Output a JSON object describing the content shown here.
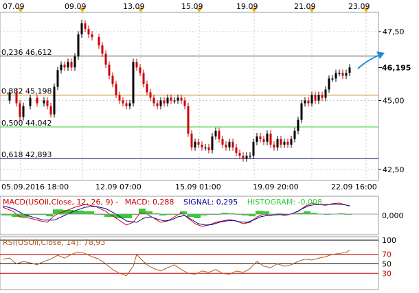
{
  "top_dates": [
    "07.09",
    "09.09",
    "13.09",
    "15.09",
    "19.09",
    "21.09",
    "23.09"
  ],
  "bottom_dates": [
    "05.09.2016 18:00",
    "12.09 07:00",
    "15.09 01:00",
    "19.09 20:00",
    "22.09 16:00"
  ],
  "price_axis": {
    "labels": [
      "47,50",
      "45,00",
      "42,50"
    ],
    "values": [
      47.5,
      45.0,
      42.5
    ]
  },
  "current_price": {
    "label": "46,195",
    "value": 46.195
  },
  "fib_levels": [
    {
      "label": "0,236 46,612",
      "value": 46.612,
      "color": "#555555"
    },
    {
      "label": "0,382 45,198",
      "value": 45.198,
      "color": "#cc7a00"
    },
    {
      "label": "0,500 44,042",
      "value": 44.042,
      "color": "#33cc33"
    },
    {
      "label": "0,618 42,893",
      "value": 42.893,
      "color": "#000066"
    }
  ],
  "macd": {
    "label_prefix": "MACD(USOil,Close, 12, 26, 9) -",
    "macd_label": "MACD: 0,288",
    "signal_label": "SIGNAL: 0,295",
    "histogram_label": "HISTOGRAM: -0,008",
    "zero_label": "0,000",
    "colors": {
      "macd": "#cc0000",
      "signal": "#000099",
      "histogram": "#33cc33"
    }
  },
  "rsi": {
    "label": "RSI(USOil,Close, 14): 78,93",
    "levels": [
      "100",
      "70",
      "50",
      "30"
    ],
    "level_values": [
      100,
      70,
      50,
      30
    ],
    "color": "#b05a1a"
  },
  "colors": {
    "bull": "#000000",
    "bear": "#cc0000",
    "arrow": "#1a8fd6",
    "marker": "#f5a623",
    "grid": "#c8c8c8"
  },
  "chart_data": {
    "type": "line",
    "title": "",
    "price_range": [
      42.1,
      48.2
    ],
    "x_range": [
      0,
      108
    ],
    "price": [
      [
        0,
        45.0
      ],
      [
        2,
        45.3
      ],
      [
        4,
        44.9
      ],
      [
        5,
        44.4
      ],
      [
        6,
        44.8
      ],
      [
        8,
        45.1
      ],
      [
        10,
        44.9
      ],
      [
        12,
        45.0
      ],
      [
        13,
        44.8
      ],
      [
        14,
        44.5
      ],
      [
        15,
        45.5
      ],
      [
        16,
        46.1
      ],
      [
        17,
        46.3
      ],
      [
        18,
        46.2
      ],
      [
        19,
        46.4
      ],
      [
        20,
        46.2
      ],
      [
        21,
        46.6
      ],
      [
        22,
        47.4
      ],
      [
        23,
        47.8
      ],
      [
        24,
        47.6
      ],
      [
        25,
        47.4
      ],
      [
        26,
        47.3
      ],
      [
        28,
        47.0
      ],
      [
        29,
        46.7
      ],
      [
        30,
        46.3
      ],
      [
        31,
        45.9
      ],
      [
        32,
        45.6
      ],
      [
        33,
        45.2
      ],
      [
        34,
        45.0
      ],
      [
        35,
        44.9
      ],
      [
        36,
        44.8
      ],
      [
        37,
        44.9
      ],
      [
        38,
        46.4
      ],
      [
        39,
        46.2
      ],
      [
        40,
        46.0
      ],
      [
        41,
        45.6
      ],
      [
        42,
        45.3
      ],
      [
        43,
        45.1
      ],
      [
        44,
        44.9
      ],
      [
        45,
        44.8
      ],
      [
        46,
        45.0
      ],
      [
        47,
        44.9
      ],
      [
        48,
        45.1
      ],
      [
        49,
        45.0
      ],
      [
        50,
        45.0
      ],
      [
        51,
        45.1
      ],
      [
        52,
        45.0
      ],
      [
        53,
        44.8
      ],
      [
        54,
        43.8
      ],
      [
        55,
        43.3
      ],
      [
        56,
        43.5
      ],
      [
        57,
        43.4
      ],
      [
        58,
        43.3
      ],
      [
        59,
        43.3
      ],
      [
        60,
        43.2
      ],
      [
        61,
        43.7
      ],
      [
        62,
        43.9
      ],
      [
        63,
        43.6
      ],
      [
        64,
        43.4
      ],
      [
        65,
        43.3
      ],
      [
        66,
        43.5
      ],
      [
        67,
        43.3
      ],
      [
        68,
        43.1
      ],
      [
        69,
        43.0
      ],
      [
        70,
        42.9
      ],
      [
        71,
        43.0
      ],
      [
        72,
        43.0
      ],
      [
        73,
        43.5
      ],
      [
        74,
        43.7
      ],
      [
        75,
        43.6
      ],
      [
        76,
        43.5
      ],
      [
        77,
        43.8
      ],
      [
        78,
        43.4
      ],
      [
        79,
        43.3
      ],
      [
        80,
        43.6
      ],
      [
        81,
        43.4
      ],
      [
        82,
        43.5
      ],
      [
        83,
        43.4
      ],
      [
        84,
        43.6
      ],
      [
        85,
        43.9
      ],
      [
        86,
        44.3
      ],
      [
        87,
        44.9
      ],
      [
        88,
        45.0
      ],
      [
        89,
        44.9
      ],
      [
        90,
        45.2
      ],
      [
        91,
        45.0
      ],
      [
        92,
        45.2
      ],
      [
        93,
        45.1
      ],
      [
        94,
        45.4
      ],
      [
        95,
        45.8
      ],
      [
        96,
        45.8
      ],
      [
        97,
        46.0
      ],
      [
        98,
        46.0
      ],
      [
        99,
        45.9
      ],
      [
        100,
        46.0
      ],
      [
        101,
        46.2
      ]
    ],
    "macd_range": [
      -0.75,
      0.55
    ],
    "macd_line": [
      [
        0,
        0.25
      ],
      [
        3,
        0.1
      ],
      [
        5,
        -0.1
      ],
      [
        8,
        -0.15
      ],
      [
        11,
        -0.25
      ],
      [
        13,
        -0.3
      ],
      [
        15,
        -0.05
      ],
      [
        18,
        0.1
      ],
      [
        21,
        0.25
      ],
      [
        24,
        0.35
      ],
      [
        27,
        0.28
      ],
      [
        30,
        0.1
      ],
      [
        33,
        -0.15
      ],
      [
        36,
        -0.4
      ],
      [
        38,
        -0.3
      ],
      [
        40,
        0.05
      ],
      [
        42,
        0.0
      ],
      [
        44,
        -0.15
      ],
      [
        46,
        -0.3
      ],
      [
        48,
        -0.25
      ],
      [
        50,
        -0.1
      ],
      [
        52,
        0.05
      ],
      [
        54,
        -0.15
      ],
      [
        56,
        -0.35
      ],
      [
        58,
        -0.45
      ],
      [
        60,
        -0.4
      ],
      [
        62,
        -0.3
      ],
      [
        64,
        -0.25
      ],
      [
        66,
        -0.2
      ],
      [
        68,
        -0.25
      ],
      [
        70,
        -0.35
      ],
      [
        72,
        -0.3
      ],
      [
        74,
        -0.1
      ],
      [
        76,
        0.0
      ],
      [
        78,
        -0.05
      ],
      [
        80,
        0.0
      ],
      [
        82,
        -0.05
      ],
      [
        84,
        0.0
      ],
      [
        86,
        0.1
      ],
      [
        88,
        0.28
      ],
      [
        90,
        0.4
      ],
      [
        92,
        0.35
      ],
      [
        94,
        0.32
      ],
      [
        96,
        0.38
      ],
      [
        98,
        0.4
      ],
      [
        100,
        0.33
      ],
      [
        101,
        0.29
      ]
    ],
    "signal_line": [
      [
        0,
        0.3
      ],
      [
        3,
        0.2
      ],
      [
        6,
        0.0
      ],
      [
        9,
        -0.12
      ],
      [
        12,
        -0.22
      ],
      [
        15,
        -0.22
      ],
      [
        18,
        -0.05
      ],
      [
        21,
        0.12
      ],
      [
        24,
        0.25
      ],
      [
        27,
        0.28
      ],
      [
        30,
        0.2
      ],
      [
        33,
        0.0
      ],
      [
        36,
        -0.25
      ],
      [
        39,
        -0.3
      ],
      [
        41,
        -0.15
      ],
      [
        43,
        -0.1
      ],
      [
        45,
        -0.18
      ],
      [
        47,
        -0.25
      ],
      [
        49,
        -0.22
      ],
      [
        51,
        -0.1
      ],
      [
        53,
        -0.05
      ],
      [
        55,
        -0.2
      ],
      [
        57,
        -0.35
      ],
      [
        59,
        -0.4
      ],
      [
        61,
        -0.38
      ],
      [
        63,
        -0.3
      ],
      [
        65,
        -0.25
      ],
      [
        67,
        -0.23
      ],
      [
        69,
        -0.28
      ],
      [
        71,
        -0.3
      ],
      [
        73,
        -0.22
      ],
      [
        75,
        -0.1
      ],
      [
        77,
        -0.05
      ],
      [
        79,
        -0.03
      ],
      [
        81,
        -0.02
      ],
      [
        83,
        -0.02
      ],
      [
        85,
        0.05
      ],
      [
        87,
        0.18
      ],
      [
        89,
        0.3
      ],
      [
        91,
        0.35
      ],
      [
        93,
        0.34
      ],
      [
        95,
        0.35
      ],
      [
        97,
        0.37
      ],
      [
        99,
        0.35
      ],
      [
        101,
        0.3
      ]
    ],
    "histogram": [
      [
        0,
        -0.05
      ],
      [
        3,
        -0.1
      ],
      [
        5,
        -0.1
      ],
      [
        8,
        -0.03
      ],
      [
        11,
        -0.03
      ],
      [
        13,
        -0.08
      ],
      [
        15,
        0.17
      ],
      [
        18,
        0.15
      ],
      [
        21,
        0.13
      ],
      [
        24,
        0.1
      ],
      [
        27,
        0.0
      ],
      [
        30,
        -0.1
      ],
      [
        33,
        -0.15
      ],
      [
        36,
        -0.15
      ],
      [
        38,
        0.0
      ],
      [
        40,
        0.2
      ],
      [
        42,
        0.1
      ],
      [
        44,
        0.03
      ],
      [
        46,
        -0.05
      ],
      [
        48,
        -0.03
      ],
      [
        50,
        0.0
      ],
      [
        52,
        0.1
      ],
      [
        54,
        -0.1
      ],
      [
        56,
        -0.15
      ],
      [
        58,
        -0.05
      ],
      [
        60,
        -0.02
      ],
      [
        62,
        0.0
      ],
      [
        64,
        0.05
      ],
      [
        66,
        0.03
      ],
      [
        68,
        -0.02
      ],
      [
        70,
        -0.05
      ],
      [
        72,
        -0.08
      ],
      [
        74,
        0.12
      ],
      [
        76,
        0.1
      ],
      [
        78,
        0.0
      ],
      [
        80,
        0.03
      ],
      [
        82,
        -0.03
      ],
      [
        84,
        0.02
      ],
      [
        86,
        0.05
      ],
      [
        88,
        0.1
      ],
      [
        90,
        0.05
      ],
      [
        92,
        0.01
      ],
      [
        94,
        -0.02
      ],
      [
        96,
        0.01
      ],
      [
        98,
        0.03
      ],
      [
        100,
        -0.02
      ],
      [
        101,
        -0.01
      ]
    ],
    "rsi_range": [
      0,
      100
    ],
    "rsi_line": [
      [
        0,
        60
      ],
      [
        2,
        62
      ],
      [
        4,
        50
      ],
      [
        6,
        55
      ],
      [
        8,
        52
      ],
      [
        10,
        48
      ],
      [
        12,
        55
      ],
      [
        14,
        60
      ],
      [
        16,
        68
      ],
      [
        18,
        62
      ],
      [
        20,
        70
      ],
      [
        22,
        75
      ],
      [
        24,
        72
      ],
      [
        26,
        65
      ],
      [
        28,
        60
      ],
      [
        30,
        50
      ],
      [
        32,
        38
      ],
      [
        34,
        30
      ],
      [
        36,
        25
      ],
      [
        38,
        45
      ],
      [
        39,
        70
      ],
      [
        40,
        62
      ],
      [
        42,
        48
      ],
      [
        44,
        40
      ],
      [
        46,
        35
      ],
      [
        48,
        42
      ],
      [
        50,
        48
      ],
      [
        52,
        38
      ],
      [
        54,
        30
      ],
      [
        56,
        28
      ],
      [
        58,
        35
      ],
      [
        60,
        32
      ],
      [
        62,
        38
      ],
      [
        64,
        30
      ],
      [
        66,
        28
      ],
      [
        68,
        35
      ],
      [
        70,
        32
      ],
      [
        72,
        40
      ],
      [
        74,
        55
      ],
      [
        76,
        45
      ],
      [
        78,
        42
      ],
      [
        80,
        50
      ],
      [
        82,
        45
      ],
      [
        84,
        48
      ],
      [
        86,
        55
      ],
      [
        88,
        60
      ],
      [
        90,
        58
      ],
      [
        92,
        62
      ],
      [
        94,
        65
      ],
      [
        96,
        70
      ],
      [
        98,
        72
      ],
      [
        100,
        74
      ],
      [
        101,
        78.93
      ]
    ]
  }
}
